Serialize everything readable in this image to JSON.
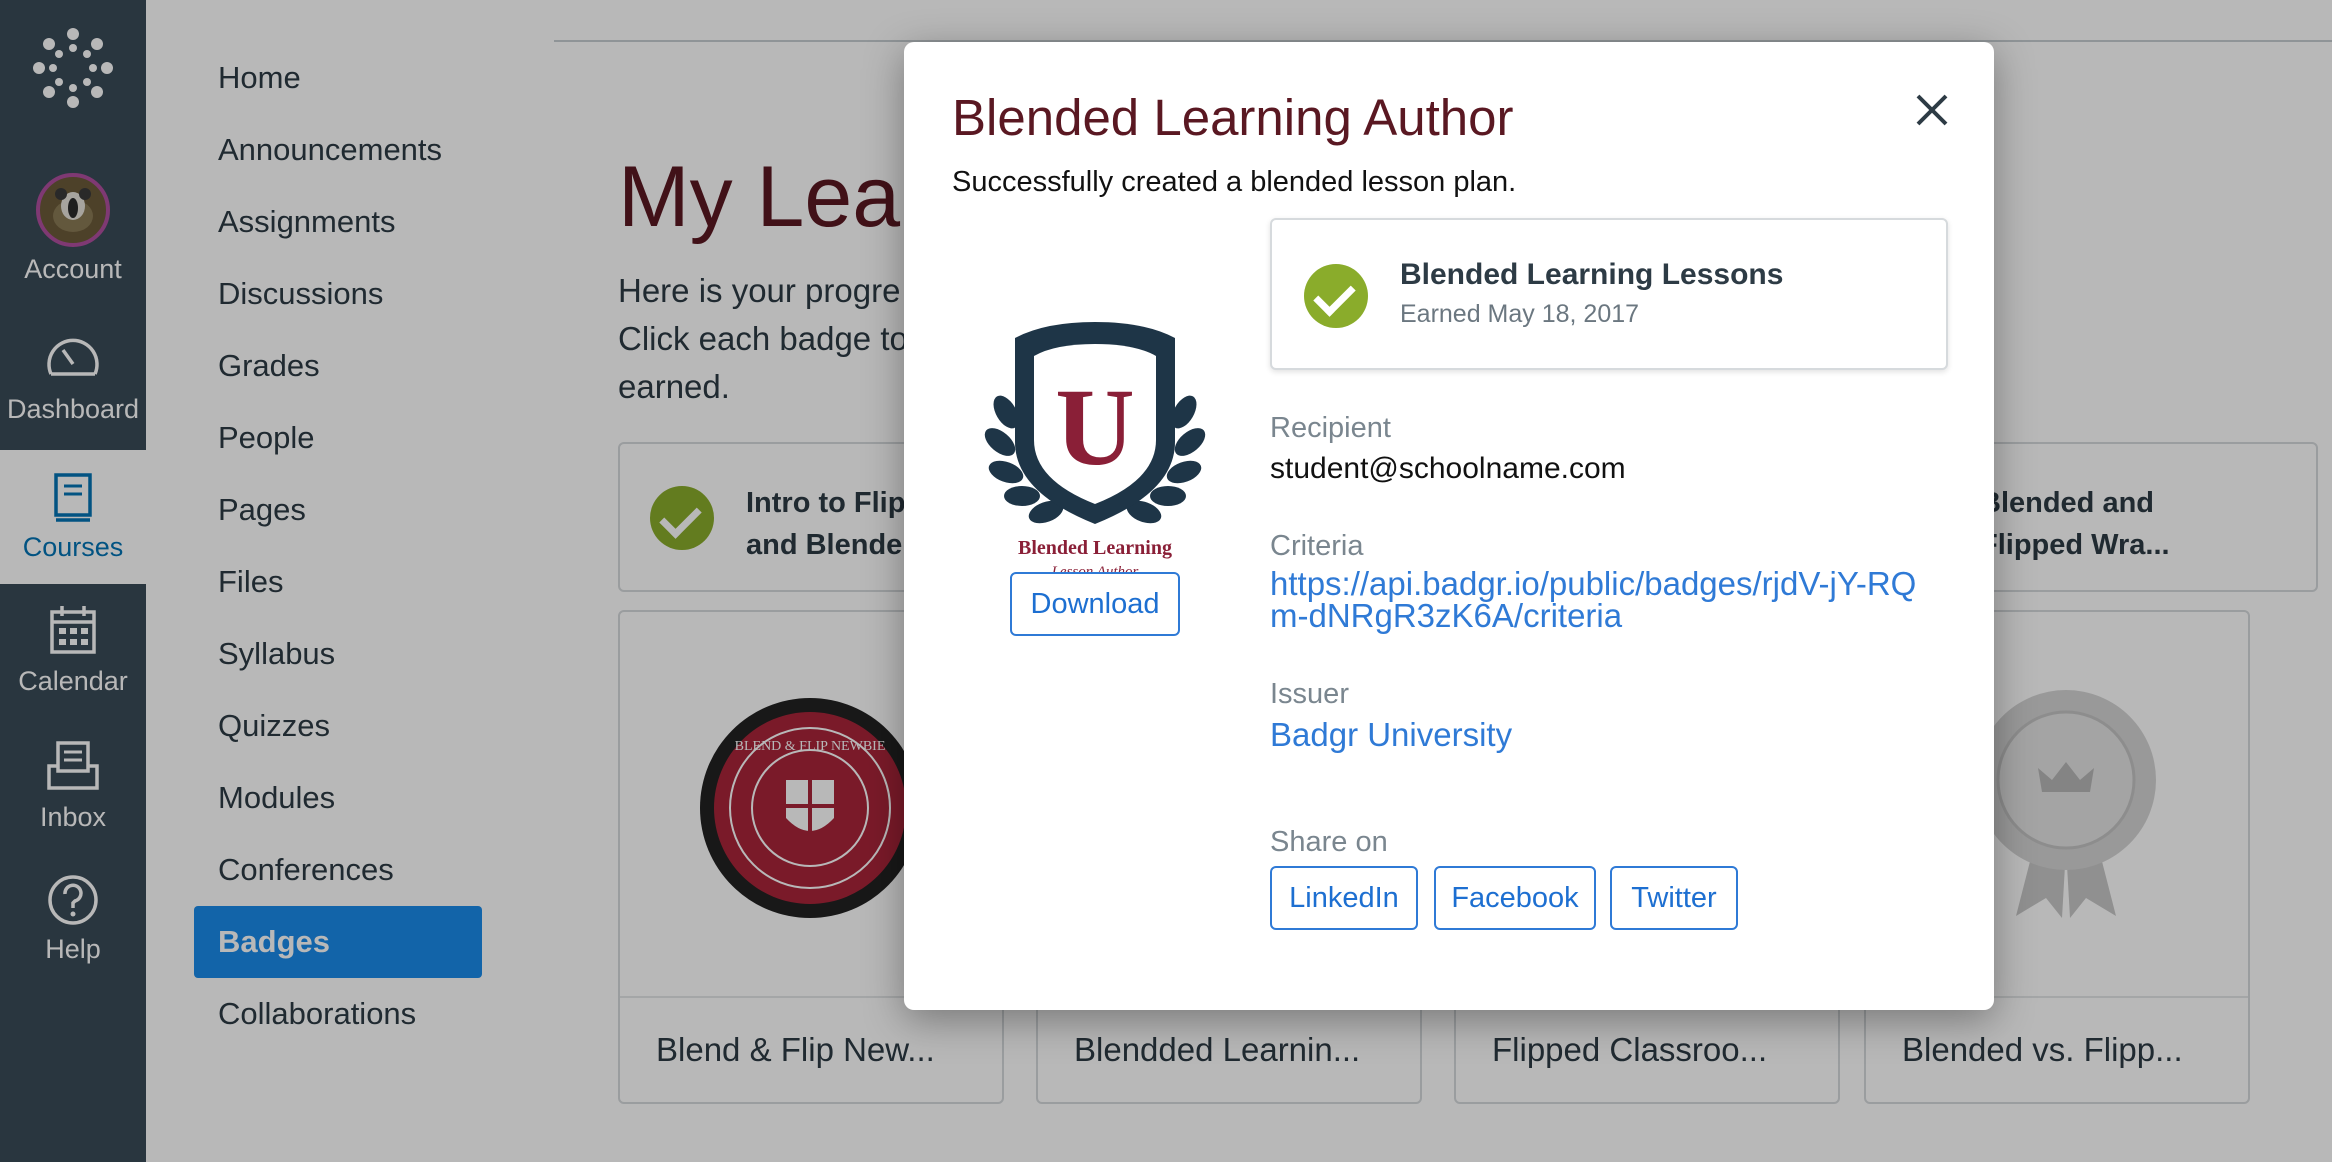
{
  "global_nav": {
    "account": "Account",
    "dashboard": "Dashboard",
    "courses": "Courses",
    "calendar": "Calendar",
    "inbox": "Inbox",
    "help": "Help"
  },
  "course_nav": {
    "items": [
      {
        "label": "Home"
      },
      {
        "label": "Announcements"
      },
      {
        "label": "Assignments"
      },
      {
        "label": "Discussions"
      },
      {
        "label": "Grades"
      },
      {
        "label": "People"
      },
      {
        "label": "Pages"
      },
      {
        "label": "Files"
      },
      {
        "label": "Syllabus"
      },
      {
        "label": "Quizzes"
      },
      {
        "label": "Modules"
      },
      {
        "label": "Conferences"
      },
      {
        "label": "Badges",
        "active": true
      },
      {
        "label": "Collaborations"
      }
    ]
  },
  "main": {
    "title": "My Lear",
    "intro_lines": [
      "Here is your progre",
      "Click each badge to",
      "earned."
    ],
    "earned_row": [
      {
        "name_line1": "Intro to Flip",
        "name_line2": "and Blende..."
      },
      {
        "name_line1": "Blended and",
        "name_line2": "Flipped Wra..."
      }
    ],
    "tiles": [
      {
        "caption": "Blend & Flip New..."
      },
      {
        "caption": "Blendded Learnin..."
      },
      {
        "caption": "Flipped Classroo..."
      },
      {
        "caption": "Blended vs. Flipp..."
      }
    ],
    "seal_text": "BLEND & FLIP NEWBIE"
  },
  "modal": {
    "title": "Blended Learning Author",
    "subtitle": "Successfully created a blended lesson plan.",
    "emblem_letter": "U",
    "emblem_line1": "Blended Learning",
    "emblem_line2": "Lesson Author",
    "download": "Download",
    "earned_badge": {
      "name": "Blended Learning Lessons",
      "date": "Earned May 18, 2017"
    },
    "recipient_label": "Recipient",
    "recipient_value": "student@schoolname.com",
    "criteria_label": "Criteria",
    "criteria_line1": "https://api.badgr.io/public/badges/rjdV-jY-RQ",
    "criteria_line2": "m-dNRgR3zK6A/criteria",
    "issuer_label": "Issuer",
    "issuer_value": "Badgr University",
    "share_label": "Share on",
    "share": {
      "linkedin": "LinkedIn",
      "facebook": "Facebook",
      "twitter": "Twitter"
    }
  },
  "colors": {
    "global_nav_bg": "#394b58",
    "active_blue": "#1a8bea",
    "title_maroon": "#5a1822",
    "check_green": "#8aac2b",
    "link_blue": "#2f7ad6"
  }
}
